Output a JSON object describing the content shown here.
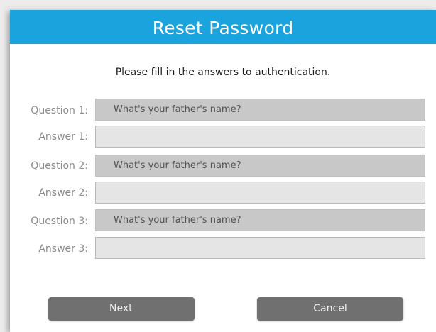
{
  "dialog": {
    "title": "Reset Password",
    "instruction": "Please fill in the answers to authentication."
  },
  "rows": [
    {
      "question_label": "Question 1:",
      "question_value": "What's your father's name?",
      "answer_label": "Answer 1:",
      "answer_value": ""
    },
    {
      "question_label": "Question 2:",
      "question_value": "What's your father's name?",
      "answer_label": "Answer 2:",
      "answer_value": ""
    },
    {
      "question_label": "Question 3:",
      "question_value": "What's your father's name?",
      "answer_label": "Answer 3:",
      "answer_value": ""
    }
  ],
  "buttons": {
    "next_label": "Next",
    "cancel_label": "Cancel"
  },
  "colors": {
    "title_bar": "#1aa3dc",
    "question_field": "#c8c8c8",
    "answer_field": "#e5e5e5",
    "button": "#707070"
  }
}
